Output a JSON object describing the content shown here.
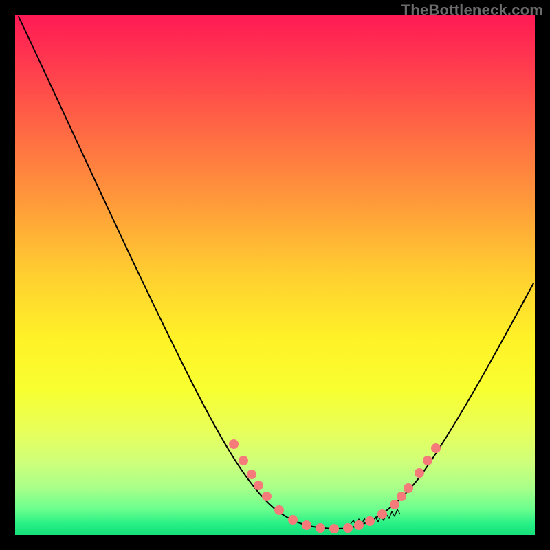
{
  "watermark": "TheBottleneck.com",
  "chart_data": {
    "type": "line",
    "title": "",
    "xlabel": "",
    "ylabel": "",
    "xlim": [
      0,
      100
    ],
    "ylim": [
      0,
      100
    ],
    "grid": false,
    "legend": false,
    "series": [
      {
        "name": "bottleneck-curve",
        "x": [
          0,
          5,
          10,
          15,
          20,
          25,
          30,
          35,
          40,
          44,
          48,
          52,
          56,
          60,
          64,
          68,
          72,
          76,
          80,
          84,
          88,
          92,
          96,
          100
        ],
        "y": [
          100,
          90,
          80,
          70,
          60,
          50,
          40,
          30,
          20,
          12,
          6,
          2,
          0.5,
          0,
          0.5,
          2,
          5,
          10,
          16,
          23,
          30,
          37,
          44,
          51
        ]
      }
    ],
    "markers": {
      "name": "highlight-points",
      "x": [
        40,
        42,
        44,
        46,
        50,
        54,
        58,
        62,
        66,
        68,
        70,
        72,
        74,
        76,
        78,
        80
      ],
      "y": [
        20,
        16,
        12,
        9,
        4,
        1,
        0,
        0,
        1,
        2,
        3.5,
        5,
        7,
        10,
        13,
        16
      ]
    },
    "background_gradient": {
      "top": "#ff1a54",
      "bottom": "#18e07a"
    }
  }
}
